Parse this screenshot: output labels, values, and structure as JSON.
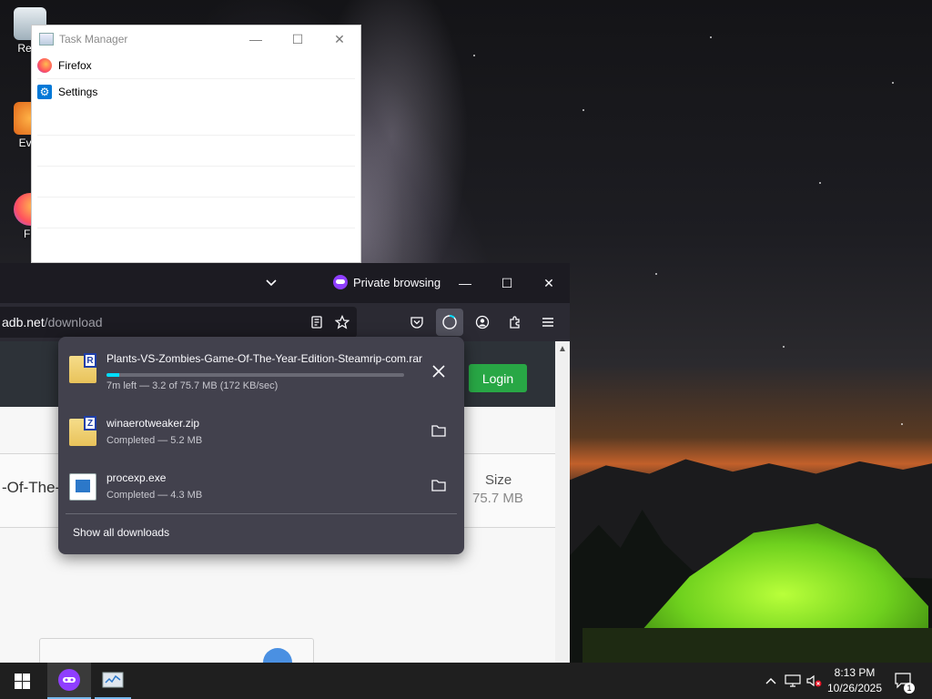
{
  "desktop": {
    "icons": [
      {
        "label": "Recy"
      },
      {
        "label": "Ever"
      },
      {
        "label": "Fir"
      }
    ]
  },
  "task_manager": {
    "title": "Task Manager",
    "controls": {
      "minimize": "—",
      "maximize": "☐",
      "close": "✕"
    },
    "rows": [
      {
        "label": "Firefox",
        "icon": "firefox-icon"
      },
      {
        "label": "Settings",
        "icon": "settings-gear-icon"
      }
    ]
  },
  "firefox": {
    "private_label": "Private browsing",
    "url_host": "adb.net",
    "url_path": "/download",
    "window_controls": {
      "minimize": "—",
      "maximize": "☐",
      "close": "✕"
    },
    "toolbar_icons": [
      "reader-view-icon",
      "bookmark-star-icon",
      "pocket-icon",
      "downloads-icon",
      "account-icon",
      "extensions-icon",
      "menu-icon"
    ]
  },
  "site": {
    "login_label": "Login",
    "title_fragment": "-Of-The-",
    "size_label": "Size",
    "size_value": "75.7 MB"
  },
  "downloads": {
    "items": [
      {
        "name": "Plants-VS-Zombies-Game-Of-The-Year-Edition-Steamrip-com.rar",
        "status": "7m left — 3.2 of 75.7 MB (172 KB/sec)",
        "progress_percent": 4.2,
        "icon": "rar-archive-icon",
        "badge": "R"
      },
      {
        "name": "winaerotweaker.zip",
        "status": "Completed — 5.2 MB",
        "icon": "zip-archive-icon",
        "badge": "Z"
      },
      {
        "name": "procexp.exe",
        "status": "Completed — 4.3 MB",
        "icon": "exe-file-icon"
      }
    ],
    "show_all_label": "Show all downloads"
  },
  "taskbar": {
    "time": "8:13 PM",
    "date": "10/26/2025",
    "notification_count": "1"
  },
  "colors": {
    "firefox_dark": "#1c1b22",
    "firefox_toolbar": "#2b2a33",
    "panel": "#42414d",
    "progress": "#00ddff",
    "login_green": "#28a745",
    "private_purple": "#8f3eff"
  }
}
